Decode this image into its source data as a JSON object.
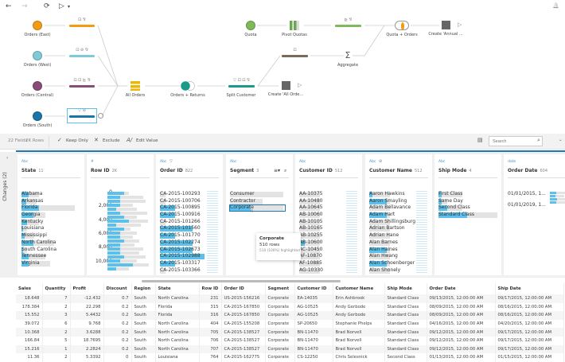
{
  "toolbar": {
    "back": "←",
    "forward": "→",
    "refresh": "⟳",
    "run": "▷",
    "run_menu": "▾",
    "notifications": "🔔"
  },
  "flow": {
    "inputs": [
      {
        "label": "Orders (East)",
        "color": "#f39c12",
        "bar": "#f39c12",
        "icons": "⊡ ⅋"
      },
      {
        "label": "Orders (West)",
        "color": "#7fcad6",
        "bar": "#7fcad6",
        "icons": "⊡ ⊘ ⅋"
      },
      {
        "label": "Orders (Central)",
        "color": "#8a4b7a",
        "bar": "#8a4b7a",
        "icons": "⊡ ⊡ ⊵ ⅋"
      },
      {
        "label": "Orders (South)",
        "color": "#1b75a8",
        "bar": "#1b75a8",
        "icons": "▽ ⊘"
      }
    ],
    "union": "All Orders",
    "join": "Orders + Returns",
    "split": "Split Customer",
    "split_icons": "▽ ⊡ ⊡ ⅋",
    "quota": "Quota",
    "pivot": "Pivot Quotas",
    "pivot_icons": "⊵ ⅋",
    "join2": "Quota + Orders",
    "output1": "Create 'Annual ...",
    "agg_icons": "⊡",
    "aggregate": "Aggregate",
    "output2": "Create 'All Orde..."
  },
  "actionbar": {
    "fields": "22 Fields",
    "rows": "2K Rows",
    "keep_only": "Keep Only",
    "exclude": "Exclude",
    "edit_value": "Edit Value",
    "search_placeholder": "Search"
  },
  "changes": "Changes (2)",
  "cards": [
    {
      "type": "Abc",
      "name": "State",
      "count": "11",
      "values": [
        "Alabama",
        "Arkansas",
        "Florida",
        "Georgia",
        "Kentucky",
        "Louisiana",
        "Mississippi",
        "North Carolina",
        "South Carolina",
        "Tennessee",
        "Virginia"
      ],
      "bg": [
        0.3,
        0.25,
        0.9,
        0.4,
        0.3,
        0.1,
        0.22,
        0.55,
        0.1,
        0.4,
        0.48
      ],
      "hl": [
        0.12,
        0.08,
        0.3,
        0.2,
        0.1,
        0.03,
        0.05,
        0.2,
        0.03,
        0.12,
        0.12
      ]
    },
    {
      "type": "#",
      "name": "Row ID",
      "count": "2K",
      "axis": [
        "0",
        "2,000",
        "4,000",
        "6,000",
        "8,000",
        "10,000"
      ]
    },
    {
      "type": "Abc",
      "name": "Order ID",
      "count": "822",
      "values": [
        "CA-2015-100293",
        "CA-2015-100706",
        "CA-2015-100895",
        "CA-2015-100916",
        "CA-2015-101266",
        "CA-2015-101560",
        "CA-2015-101770",
        "CA-2015-102274",
        "CA-2015-102673",
        "CA-2015-102988",
        "CA-2015-103317",
        "CA-2015-103366"
      ],
      "bg": [
        0.1,
        0.1,
        0.1,
        0.1,
        0.1,
        0.1,
        0.1,
        0.1,
        0.1,
        0.1,
        0.1,
        0.1
      ],
      "hl": [
        0,
        0,
        0.25,
        0.25,
        0,
        0.55,
        0.25,
        0.55,
        0.55,
        0.75,
        0.25,
        0
      ]
    },
    {
      "type": "Abc",
      "name": "Segment",
      "count": "3",
      "values": [
        "Consumer",
        "Contractor",
        "Corporate"
      ],
      "bg": [
        0.9,
        0.55,
        0.9
      ],
      "hl": [
        0,
        0,
        0.35
      ]
    },
    {
      "type": "Abc",
      "name": "Customer ID",
      "count": "512",
      "values": [
        "AA-10375",
        "AA-10480",
        "AA-10645",
        "AB-10060",
        "AB-10105",
        "AB-10165",
        "AB-10255",
        "AB-10600",
        "AC-10450",
        "AF-10870",
        "AF-10885",
        "AG-10330"
      ],
      "bg": [
        0.35,
        0.35,
        0.35,
        0.35,
        0.35,
        0.35,
        0.35,
        0.35,
        0.35,
        0.35,
        0.35,
        0.35
      ],
      "hl": [
        0,
        0,
        0,
        0,
        0,
        0,
        0,
        0.1,
        0,
        0,
        0,
        0
      ]
    },
    {
      "type": "Abc",
      "name": "Customer Name",
      "count": "512",
      "values": [
        "Aaron Hawkins",
        "Aaron Smayling",
        "Adam Bellavance",
        "Adam Hart",
        "Adam Shillingsburg",
        "Adrian Bartson",
        "Adrian Hane",
        "Alan Barnes",
        "Alan Haines",
        "Alan Hwang",
        "Alan Schoenberger",
        "Alan Shonely"
      ],
      "bg": [
        0.35,
        0.35,
        0.35,
        0.35,
        0.35,
        0.35,
        0.35,
        0.35,
        0.35,
        0.35,
        0.35,
        0.35
      ],
      "hl": [
        0.05,
        0.3,
        0,
        0.3,
        0,
        0,
        0,
        0,
        0.3,
        0,
        0.3,
        0
      ]
    },
    {
      "type": "Abc",
      "name": "Ship Mode",
      "count": "4",
      "values": [
        "First Class",
        "Same Day",
        "Second Class",
        "Standard Class"
      ],
      "bg": [
        0.4,
        0.15,
        0.4,
        1.0
      ],
      "hl": [
        0.05,
        0.05,
        0.15,
        0.48
      ]
    },
    {
      "type": "date",
      "name": "Order Date",
      "count": "604",
      "values": [
        "01/01/2015, 1...",
        "01/01/2019, 1..."
      ]
    }
  ],
  "tooltip": {
    "title": "Corporate",
    "rows": "510 rows",
    "detail": "510 (100%) highlighted"
  },
  "grid": {
    "columns": [
      "Sales",
      "Quantity",
      "Profit",
      "Discount",
      "Region",
      "State",
      "Row ID",
      "Order ID",
      "Segment",
      "Customer ID",
      "Customer Name",
      "Ship Mode",
      "Order Date",
      "Ship Date"
    ],
    "rows": [
      [
        "18.648",
        "7",
        "-12.432",
        "0.7",
        "South",
        "North Carolina",
        "231",
        "US-2015-156216",
        "Corporate",
        "EA-14035",
        "Erin Ashbrook",
        "Standard Class",
        "09/13/2015, 12:00:00 AM",
        "09/17/2015, 12:00:00 AM"
      ],
      [
        "178.384",
        "2",
        "22.298",
        "0.2",
        "South",
        "Florida",
        "315",
        "CA-2015-167850",
        "Corporate",
        "AG-10525",
        "Andy Gerbode",
        "Standard Class",
        "08/09/2015, 12:00:00 AM",
        "08/16/2015, 12:00:00 AM"
      ],
      [
        "15.552",
        "3",
        "5.4432",
        "0.2",
        "South",
        "Florida",
        "316",
        "CA-2015-167850",
        "Corporate",
        "AG-10525",
        "Andy Gerbode",
        "Standard Class",
        "08/09/2015, 12:00:00 AM",
        "08/16/2015, 12:00:00 AM"
      ],
      [
        "39.072",
        "6",
        "9.768",
        "0.2",
        "South",
        "North Carolina",
        "404",
        "CA-2015-155208",
        "Corporate",
        "SP-20650",
        "Stephanie Phelps",
        "Standard Class",
        "04/16/2015, 12:00:00 AM",
        "04/20/2015, 12:00:00 AM"
      ],
      [
        "10.368",
        "2",
        "3.6288",
        "0.2",
        "South",
        "North Carolina",
        "705",
        "CA-2015-138527",
        "Corporate",
        "BN-11470",
        "Brad Norvell",
        "Standard Class",
        "09/12/2015, 12:00:00 AM",
        "09/17/2015, 12:00:00 AM"
      ],
      [
        "166.84",
        "5",
        "18.7695",
        "0.2",
        "South",
        "North Carolina",
        "706",
        "CA-2015-138527",
        "Corporate",
        "BN-11470",
        "Brad Norvell",
        "Standard Class",
        "09/12/2015, 12:00:00 AM",
        "09/17/2015, 12:00:00 AM"
      ],
      [
        "15.216",
        "1",
        "2.2824",
        "0.2",
        "South",
        "North Carolina",
        "707",
        "CA-2015-138527",
        "Corporate",
        "BN-11470",
        "Brad Norvell",
        "Standard Class",
        "09/12/2015, 12:00:00 AM",
        "09/17/2015, 12:00:00 AM"
      ],
      [
        "11.36",
        "2",
        "5.3392",
        "0",
        "South",
        "Louisiana",
        "764",
        "CA-2015-162775",
        "Corporate",
        "CS-12250",
        "Chris Selesnick",
        "Second Class",
        "01/13/2015, 12:00:00 AM",
        "01/15/2015, 12:00:00 AM"
      ]
    ]
  },
  "colors": {
    "accent": "#1f77b4",
    "highlight": "#5bc0eb"
  }
}
